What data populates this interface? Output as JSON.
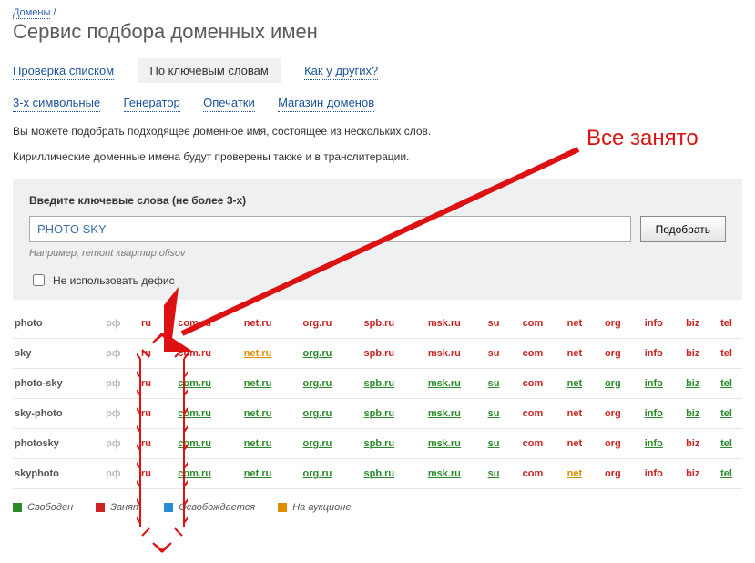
{
  "breadcrumb": {
    "root": "Домены",
    "sep": "/"
  },
  "title": "Сервис подбора доменных имен",
  "tabs1": {
    "list": "Проверка списком",
    "keywords": "По ключевым словам",
    "others": "Как у других?"
  },
  "tabs2": {
    "three": "3-х символьные",
    "gen": "Генератор",
    "typo": "Опечатки",
    "shop": "Магазин доменов"
  },
  "desc1": "Вы можете подобрать подходящее доменное имя, состоящее из нескольких слов.",
  "desc2": "Кириллические доменные имена будут проверены также и в транслитерации.",
  "panel": {
    "label": "Введите ключевые слова (не более 3-х)",
    "value": "PHOTO SKY",
    "btn": "Подобрать",
    "hint": "Например, remont квартир ofisov",
    "chk": "Не использовать дефис"
  },
  "zones": [
    "рф",
    "ru",
    "com.ru",
    "net.ru",
    "org.ru",
    "spb.ru",
    "msk.ru",
    "su",
    "com",
    "net",
    "org",
    "info",
    "biz",
    "tel"
  ],
  "rows": [
    {
      "name": "photo",
      "st": [
        "g",
        "t",
        "t",
        "t",
        "t",
        "t",
        "t",
        "t",
        "t",
        "t",
        "t",
        "t",
        "t",
        "t"
      ]
    },
    {
      "name": "sky",
      "st": [
        "g",
        "t",
        "t",
        "a",
        "f",
        "t",
        "t",
        "t",
        "t",
        "t",
        "t",
        "t",
        "t",
        "t"
      ]
    },
    {
      "name": "photo-sky",
      "st": [
        "g",
        "t",
        "f",
        "f",
        "f",
        "f",
        "f",
        "f",
        "t",
        "f",
        "f",
        "f",
        "f",
        "f"
      ]
    },
    {
      "name": "sky-photo",
      "st": [
        "g",
        "t",
        "f",
        "f",
        "f",
        "f",
        "f",
        "f",
        "t",
        "t",
        "t",
        "f",
        "f",
        "f"
      ]
    },
    {
      "name": "photosky",
      "st": [
        "g",
        "t",
        "f",
        "f",
        "f",
        "f",
        "f",
        "f",
        "t",
        "t",
        "t",
        "f",
        "t",
        "f"
      ]
    },
    {
      "name": "skyphoto",
      "st": [
        "g",
        "t",
        "f",
        "f",
        "f",
        "f",
        "f",
        "f",
        "t",
        "a",
        "t",
        "t",
        "t",
        "f"
      ]
    }
  ],
  "legend": {
    "free": "Свободен",
    "taken": "Занят",
    "rel": "Освобождается",
    "auc": "На аукционе"
  },
  "anno": "Все занято"
}
